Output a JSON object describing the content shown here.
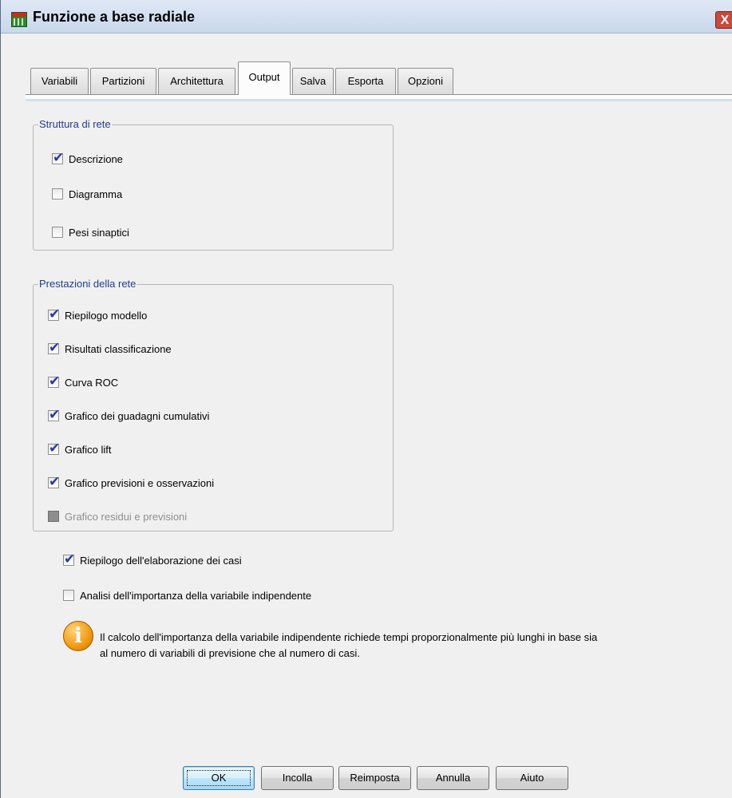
{
  "window": {
    "title": "Funzione a base radiale",
    "icon": "spss-data-table-icon",
    "close_label": "X"
  },
  "tabs": [
    {
      "label": "Variabili",
      "active": false
    },
    {
      "label": "Partizioni",
      "active": false
    },
    {
      "label": "Architettura",
      "active": false
    },
    {
      "label": "Output",
      "active": true
    },
    {
      "label": "Salva",
      "active": false
    },
    {
      "label": "Esporta",
      "active": false
    },
    {
      "label": "Opzioni",
      "active": false
    }
  ],
  "network_structure": {
    "legend": "Struttura di rete",
    "items": [
      {
        "label": "Descrizione",
        "checked": true,
        "enabled": true
      },
      {
        "label": "Diagramma",
        "checked": false,
        "enabled": true
      },
      {
        "label": "Pesi sinaptici",
        "checked": false,
        "enabled": true
      }
    ]
  },
  "network_performance": {
    "legend": "Prestazioni della rete",
    "items": [
      {
        "label": "Riepilogo modello",
        "checked": true,
        "enabled": true
      },
      {
        "label": "Risultati classificazione",
        "checked": true,
        "enabled": true
      },
      {
        "label": "Curva ROC",
        "checked": true,
        "enabled": true
      },
      {
        "label": "Grafico dei guadagni cumulativi",
        "checked": true,
        "enabled": true
      },
      {
        "label": "Grafico lift",
        "checked": true,
        "enabled": true
      },
      {
        "label": "Grafico previsioni e osservazioni",
        "checked": true,
        "enabled": true
      },
      {
        "label": "Grafico residui e previsioni",
        "checked": false,
        "enabled": false
      }
    ]
  },
  "extra_options": [
    {
      "label": "Riepilogo dell'elaborazione dei casi",
      "checked": true,
      "enabled": true
    },
    {
      "label": "Analisi dell'importanza della variabile indipendente",
      "checked": false,
      "enabled": true
    }
  ],
  "info": {
    "icon": "info-icon",
    "line1": "Il calcolo dell'importanza della variabile indipendente richiede tempi proporzionalmente più lunghi in base sia",
    "line2": "al numero di variabili di previsione che al numero di casi."
  },
  "buttons": {
    "ok": "OK",
    "paste": "Incolla",
    "reset": "Reimposta",
    "cancel": "Annulla",
    "help": "Aiuto"
  },
  "colors": {
    "legend_text": "#1f3e8a",
    "check_mark": "#2a3a9c",
    "dialog_bg": "#f0f0f0",
    "title_bar": "#c9d7ec"
  }
}
